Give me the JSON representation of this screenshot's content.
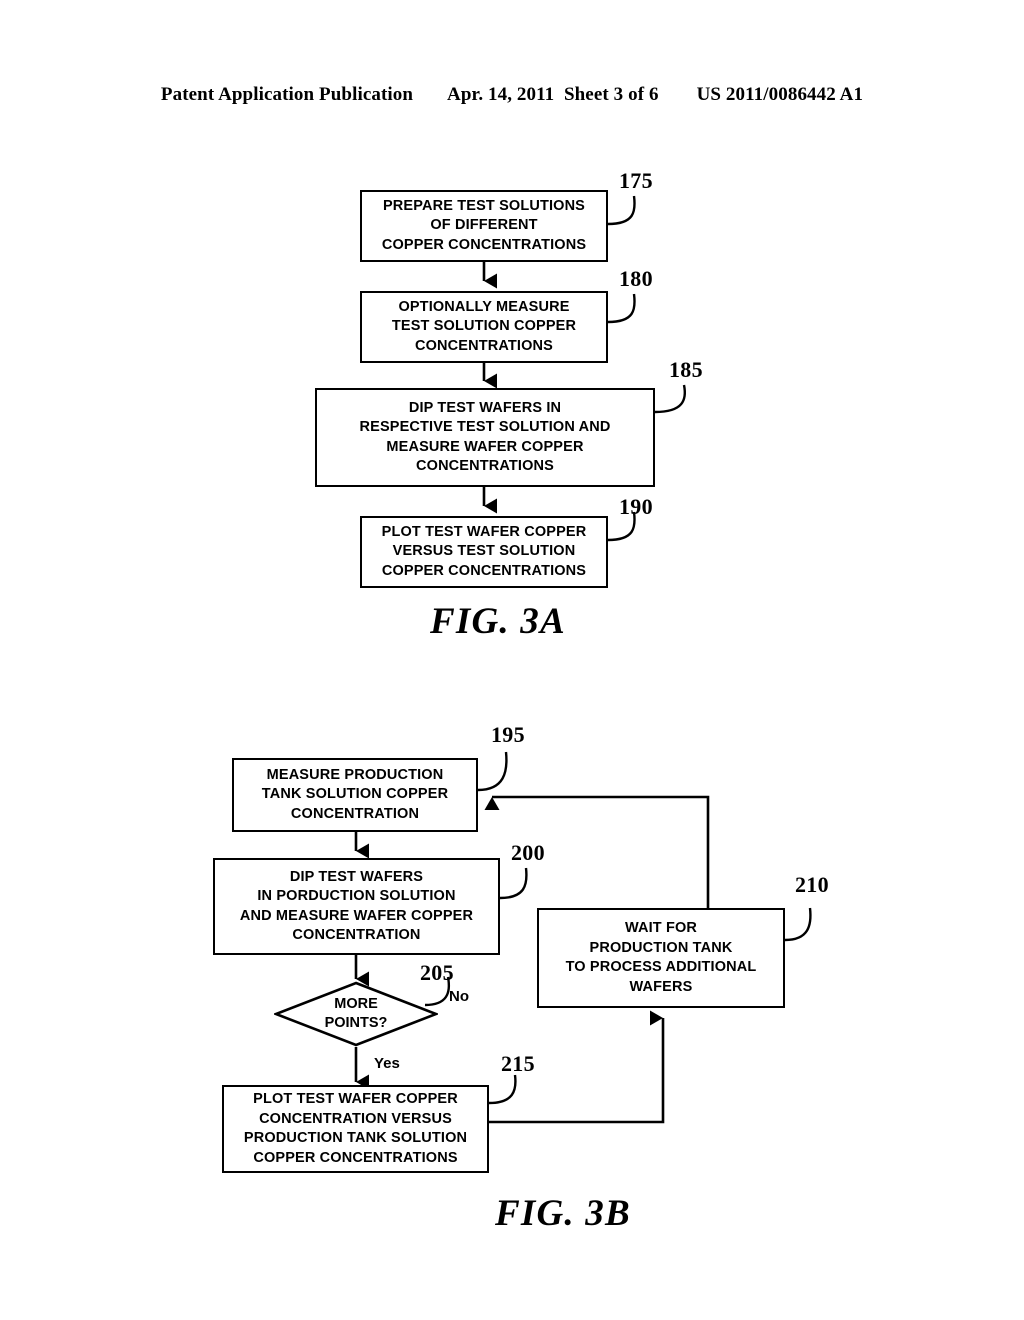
{
  "header": {
    "left": "Patent Application Publication",
    "middle": "Apr. 14, 2011  Sheet 3 of 6",
    "right": "US 2011/0086442 A1"
  },
  "figures": [
    {
      "caption": "FIG. 3A",
      "nodes": [
        {
          "ref": "175",
          "text": "PREPARE TEST SOLUTIONS\nOF DIFFERENT\nCOPPER CONCENTRATIONS"
        },
        {
          "ref": "180",
          "text": "OPTIONALLY MEASURE\nTEST SOLUTION COPPER\nCONCENTRATIONS"
        },
        {
          "ref": "185",
          "text": "DIP TEST WAFERS IN\nRESPECTIVE TEST SOLUTION AND\nMEASURE WAFER COPPER\nCONCENTRATIONS"
        },
        {
          "ref": "190",
          "text": "PLOT TEST WAFER COPPER\nVERSUS TEST SOLUTION\nCOPPER CONCENTRATIONS"
        }
      ]
    },
    {
      "caption": "FIG. 3B",
      "nodes": [
        {
          "ref": "195",
          "text": "MEASURE PRODUCTION\nTANK SOLUTION COPPER\nCONCENTRATION"
        },
        {
          "ref": "200",
          "text": "DIP TEST WAFERS\nIN PORDUCTION SOLUTION\nAND MEASURE WAFER COPPER\nCONCENTRATION"
        },
        {
          "ref": "205",
          "text": "MORE\nPOINTS?"
        },
        {
          "ref": "210",
          "text": "WAIT FOR\nPRODUCTION TANK\nTO PROCESS ADDITIONAL\nWAFERS"
        },
        {
          "ref": "215",
          "text": "PLOT TEST WAFER COPPER\nCONCENTRATION VERSUS\nPRODUCTION TANK SOLUTION\nCOPPER CONCENTRATIONS"
        }
      ],
      "branches": {
        "no": "No",
        "yes": "Yes"
      }
    }
  ]
}
